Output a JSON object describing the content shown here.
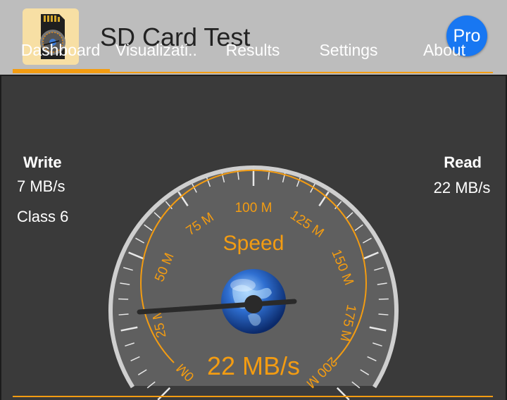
{
  "app": {
    "title": "SD Card Test",
    "pro_label": "Pro",
    "icon": "sd-card-icon"
  },
  "tabs": [
    {
      "label": "Dashboard",
      "selected": true
    },
    {
      "label": "Visualizati..",
      "selected": false
    },
    {
      "label": "Results",
      "selected": false
    },
    {
      "label": "Settings",
      "selected": false
    },
    {
      "label": "About",
      "selected": false
    }
  ],
  "write": {
    "label": "Write",
    "value": "7 MB/s",
    "class_label": "Class 6"
  },
  "read": {
    "label": "Read",
    "value": "22 MB/s"
  },
  "gauge": {
    "title": "Speed",
    "reading": "22 MB/s",
    "needle_value": 22,
    "min": 0,
    "max": 200,
    "ticks": [
      "0M",
      "25 M",
      "50 M",
      "75 M",
      "100 M",
      "125 M",
      "150 M",
      "175 M",
      "200 M"
    ],
    "center_icon": "globe-icon"
  },
  "colors": {
    "accent": "#f39c12",
    "background": "#3a3a3a",
    "appbar": "#bdbdbd",
    "pro_badge": "#1877f2"
  }
}
